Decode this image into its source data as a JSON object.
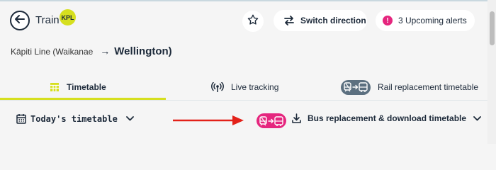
{
  "header": {
    "mode_title": "Train",
    "line_badge": "KPL",
    "switch_direction_label": "Switch direction",
    "alerts_count": "!",
    "alerts_label": "3 Upcoming alerts"
  },
  "route": {
    "from": "Kāpiti Line (Waikanae",
    "arrow": "→",
    "to": "Wellington)"
  },
  "tabs": [
    {
      "label": "Timetable",
      "icon": "timetable-icon",
      "active": true
    },
    {
      "label": "Live tracking",
      "icon": "live-tracking-icon",
      "active": false
    },
    {
      "label": "Rail replacement timetable",
      "icon": "rail-replacement-icon",
      "active": false
    }
  ],
  "toolbar": {
    "today_label": "Today's timetable",
    "download_label": "Bus replacement & download timetable"
  },
  "colors": {
    "accent": "#d6df1f",
    "alert": "#e5267e",
    "annotation_arrow": "#e32119",
    "text": "#1d2a3a"
  }
}
